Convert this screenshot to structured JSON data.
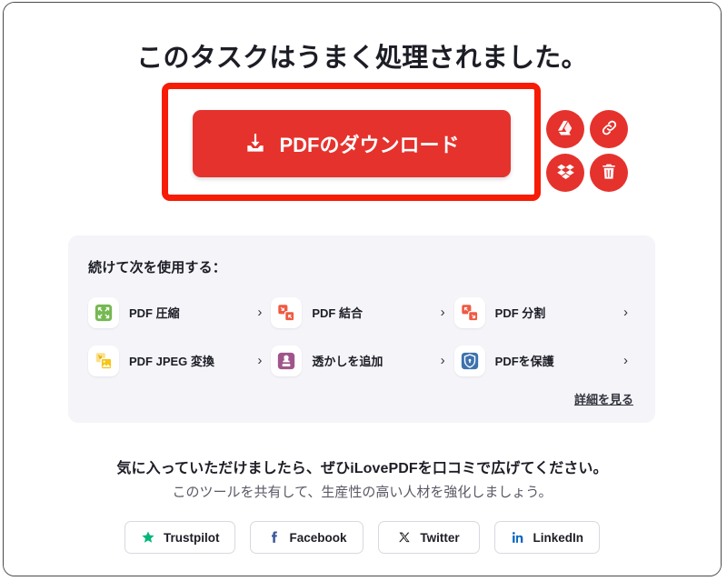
{
  "page": {
    "title": "このタスクはうまく処理されました。"
  },
  "download": {
    "button_label": "PDFのダウンロード",
    "icon": "download-icon",
    "button_color": "#e5322d",
    "highlight_color": "#f71c06",
    "side_actions": [
      {
        "name": "google-drive",
        "icon": "google-drive-icon"
      },
      {
        "name": "copy-link",
        "icon": "link-icon"
      },
      {
        "name": "dropbox",
        "icon": "dropbox-icon"
      },
      {
        "name": "delete",
        "icon": "trash-icon"
      }
    ]
  },
  "tools": {
    "heading": "続けて次を使用する：",
    "chevron": "›",
    "more_label": "詳細を見る",
    "items": [
      {
        "label": "PDF 圧縮",
        "icon": "compress-pdf-icon",
        "color": "#76b852"
      },
      {
        "label": "PDF 結合",
        "icon": "merge-pdf-icon",
        "color": "#ef5a42"
      },
      {
        "label": "PDF 分割",
        "icon": "split-pdf-icon",
        "color": "#ef5a42"
      },
      {
        "label": "PDF JPEG 変換",
        "icon": "pdf-to-jpeg-icon",
        "color": "#f5c518"
      },
      {
        "label": "透かしを追加",
        "icon": "watermark-icon",
        "color": "#a0558a"
      },
      {
        "label": "PDFを保護",
        "icon": "protect-pdf-icon",
        "color": "#3d72ad"
      }
    ]
  },
  "share": {
    "line1": "気に入っていただけましたら、ぜひiLovePDFを口コミで広げてください。",
    "line2": "このツールを共有して、生産性の高い人材を強化しましょう。",
    "buttons": [
      {
        "label": "Trustpilot",
        "icon": "trustpilot-star-icon",
        "color": "#00b67a"
      },
      {
        "label": "Facebook",
        "icon": "facebook-icon",
        "color": "#3b5998"
      },
      {
        "label": "Twitter",
        "icon": "twitter-x-icon",
        "color": "#111111"
      },
      {
        "label": "LinkedIn",
        "icon": "linkedin-icon",
        "color": "#0a66c2"
      }
    ]
  }
}
